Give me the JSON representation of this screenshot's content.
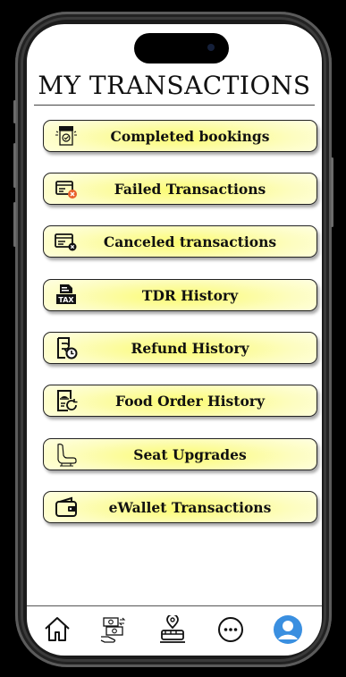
{
  "page": {
    "title": "MY TRANSACTIONS"
  },
  "menu": [
    {
      "label": "Completed bookings",
      "icon": "shop-icon"
    },
    {
      "label": "Failed Transactions",
      "icon": "card-error-icon"
    },
    {
      "label": "Canceled transactions",
      "icon": "card-cancel-icon"
    },
    {
      "label": "TDR History",
      "icon": "tax-icon"
    },
    {
      "label": "Refund History",
      "icon": "refund-icon"
    },
    {
      "label": "Food Order History",
      "icon": "food-order-icon"
    },
    {
      "label": "Seat Upgrades",
      "icon": "seat-icon"
    },
    {
      "label": "eWallet Transactions",
      "icon": "wallet-icon"
    }
  ],
  "navbar": [
    {
      "icon": "home-icon"
    },
    {
      "icon": "payment-icon"
    },
    {
      "icon": "train-location-icon"
    },
    {
      "icon": "more-icon"
    },
    {
      "icon": "profile-icon"
    }
  ],
  "colors": {
    "button_center": "#fbfb70",
    "profile_accent": "#3a8fe0"
  }
}
